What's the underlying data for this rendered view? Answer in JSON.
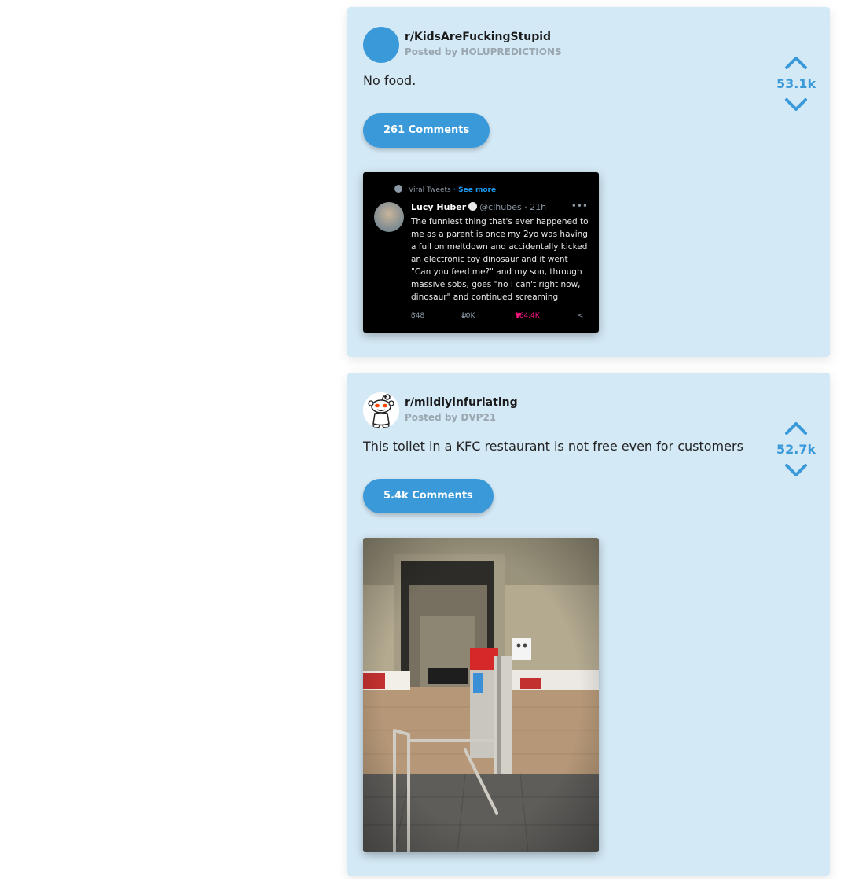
{
  "posts": [
    {
      "subreddit": "r/KidsAreFuckingStupid",
      "posted_by": "Posted by HOLUPREDICTIONS",
      "title": "No food.",
      "comments_label": "261 Comments",
      "score": "53.1k",
      "avatar": "blue-circle",
      "image": {
        "kind": "tweet-screenshot",
        "header_label": "Viral Tweets",
        "header_link": "· See more",
        "author_name": "Lucy Huber",
        "author_handle": "@clhubes · 21h",
        "text": "The funniest thing that's ever happened to me as a parent is once my 2yo was having a full on meltdown and accidentally kicked an electronic toy dinosaur and it went \"Can you feed me?\" and my son, through massive sobs, goes \"no I can't right now, dinosaur\" and continued screaming",
        "replies": "348",
        "retweets": "10K",
        "likes": "164.4K"
      }
    },
    {
      "subreddit": "r/mildlyinfuriating",
      "posted_by": "Posted by DVP21",
      "title": "This toilet in a KFC restaurant is not free even for customers",
      "comments_label": "5.4k Comments",
      "score": "52.7k",
      "avatar": "snoo-icon",
      "image": {
        "kind": "photo",
        "subject": "restroom-turnstile"
      }
    }
  ],
  "colors": {
    "card_bg": "#d4e9f6",
    "accent": "#3a9ad9",
    "tweet_bg": "#000000",
    "like_color": "#f91880"
  }
}
